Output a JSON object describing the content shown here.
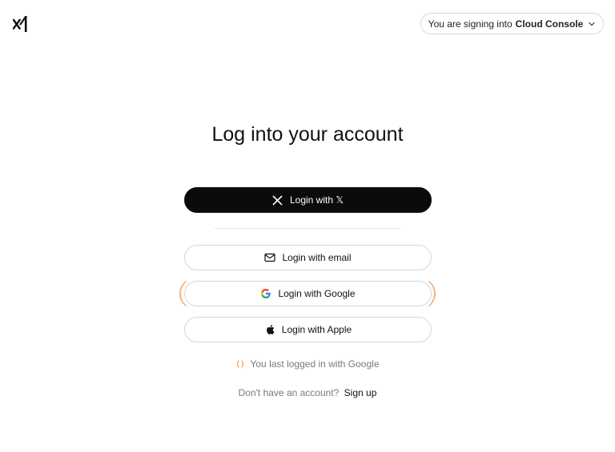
{
  "header": {
    "logo_icon": "xai-logo-icon",
    "context_prefix": "You are signing into",
    "context_product": "Cloud Console",
    "context_chevron_icon": "chevron-down-icon"
  },
  "main": {
    "title": "Log into your account",
    "buttons": {
      "x": {
        "label": "Login with 𝕏",
        "icon": "x-logo-icon"
      },
      "email": {
        "label": "Login with email",
        "icon": "mail-icon"
      },
      "google": {
        "label": "Login with Google",
        "icon": "google-icon"
      },
      "apple": {
        "label": "Login with Apple",
        "icon": "apple-icon"
      }
    },
    "last_login_text": "You last logged in with Google",
    "signup_prompt": "Don't have an account?",
    "signup_link": "Sign up"
  },
  "colors": {
    "primary_button": "#0b0b0b",
    "highlight": "#f2a36b",
    "muted_text": "#7a7a7a"
  }
}
